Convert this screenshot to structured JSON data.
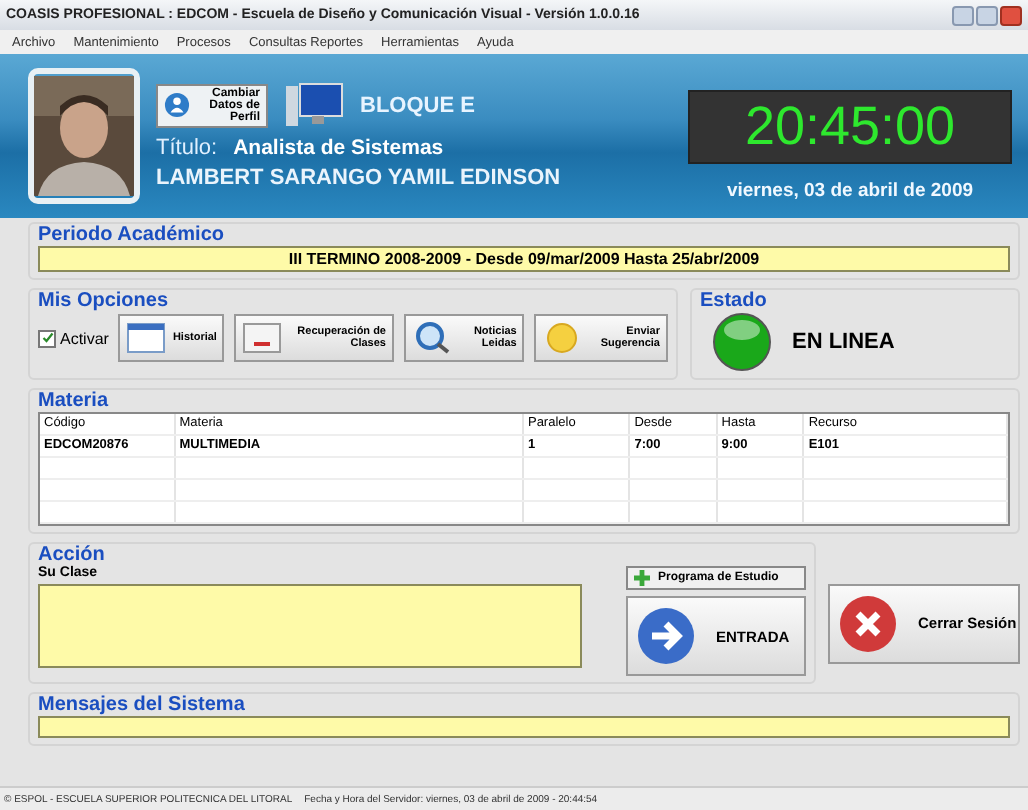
{
  "window": {
    "title": "COASIS PROFESIONAL : EDCOM - Escuela de Diseño y Comunicación Visual - Versión 1.0.0.16"
  },
  "menu": [
    "Archivo",
    "Mantenimiento",
    "Procesos",
    "Consultas Reportes",
    "Herramientas",
    "Ayuda"
  ],
  "header": {
    "profile_button": "Cambiar Datos de Perfil",
    "block": "BLOQUE E",
    "title_label": "Título:",
    "title": "Analista de Sistemas",
    "name": "LAMBERT SARANGO YAMIL EDINSON",
    "clock": "20:45:00",
    "date": "viernes, 03 de abril de 2009"
  },
  "period": {
    "heading": "Periodo Académico",
    "value": "III TERMINO 2008-2009 - Desde 09/mar/2009 Hasta 25/abr/2009"
  },
  "options": {
    "heading": "Mis Opciones",
    "activate": {
      "label": "Activar",
      "checked": true
    },
    "buttons": [
      {
        "kind": "window",
        "label": "Historial"
      },
      {
        "kind": "document",
        "label": "Recuperación de Clases"
      },
      {
        "kind": "search",
        "label": "Noticias Leidas"
      },
      {
        "kind": "smiley",
        "label": "Enviar Sugerencia"
      }
    ]
  },
  "status": {
    "heading": "Estado",
    "online": true,
    "text": "EN LINEA"
  },
  "subjects": {
    "heading": "Materia",
    "columns": [
      "Código",
      "Materia",
      "Paralelo",
      "Desde",
      "Hasta",
      "Recurso"
    ],
    "rows": [
      [
        "EDCOM20876",
        "MULTIMEDIA",
        "1",
        "7:00",
        "9:00",
        "E101"
      ]
    ]
  },
  "action": {
    "heading": "Acción",
    "field_label": "Su Clase",
    "program_button": "Programa de Estudio",
    "enter_button": "ENTRADA",
    "logout_button": "Cerrar Sesión"
  },
  "messages": {
    "heading": "Mensajes del Sistema"
  },
  "status_bar": [
    "© ESPOL - ESCUELA SUPERIOR POLITECNICA DEL LITORAL",
    "Fecha y Hora del Servidor: viernes, 03 de abril de 2009 - 20:44:54"
  ]
}
